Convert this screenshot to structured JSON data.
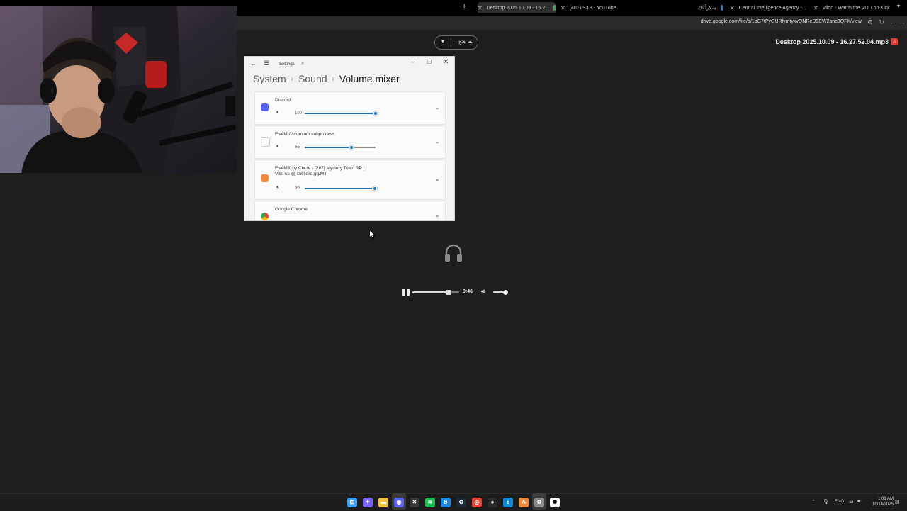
{
  "browser": {
    "tabs": [
      {
        "title": "Desktop 2025.10.09 - 16.2...",
        "favicon": "drive-icon",
        "color": "#34a853"
      },
      {
        "title": "(401) SXB - YouTube",
        "favicon": "youtube-icon",
        "color": "#ff0033"
      },
      {
        "title": "شكراً لك",
        "favicon": "blue-app-icon",
        "color": "#1e88e5"
      },
      {
        "title": "Central Intelligence Agency -...",
        "favicon": "green-square-icon",
        "color": "#43a047"
      },
      {
        "title": "Vilon - Watch the VOD on Kick",
        "favicon": "kick-icon",
        "color": "#53fc18"
      }
    ],
    "url": "drive.google.com/file/d/1oG7tPyGURlymtyxvQNReD9EW2anc3QFK/view"
  },
  "viewer": {
    "file_title": "Desktop 2025.10.09 - 16.27.52.04.mp3",
    "pill_text": "...فتح",
    "player": {
      "time": "0:46",
      "progress": 0.78,
      "volume": 0.85
    }
  },
  "settings": {
    "title": "Settings",
    "breadcrumb": [
      "System",
      "Sound",
      "Volume mixer"
    ],
    "apps": [
      {
        "name": "Discord",
        "volume": "100",
        "level": 1.0,
        "icon": "discord-icon",
        "color": "#5865f2"
      },
      {
        "name": "FiveM Chromium subprocess",
        "volume": "66",
        "level": 0.66,
        "icon": "blank-app-icon",
        "color": "#ffffff"
      },
      {
        "name": "FiveM® by Cfx.re - [262] Mystery Town RP |",
        "name2": "Visit us @ Discord.gg/MT",
        "volume": "99",
        "level": 0.99,
        "icon": "fivem-icon",
        "color": "#f0883e"
      },
      {
        "name": "Google Chrome",
        "icon": "chrome-icon",
        "color": "#fbbc05"
      }
    ]
  },
  "taskbar": {
    "language": "ENG",
    "time": "1:01 AM",
    "date": "10/14/2025",
    "pinned": [
      {
        "name": "windows-start-icon",
        "color": "#3aa0ff"
      },
      {
        "name": "copilot-icon",
        "color": "#7b61ff"
      },
      {
        "name": "file-explorer-icon",
        "color": "#f5c242"
      },
      {
        "name": "discord-taskbar-icon",
        "color": "#5865f2"
      },
      {
        "name": "xbox-icon",
        "color": "#3a3a3a"
      },
      {
        "name": "spotify-icon",
        "color": "#1db954"
      },
      {
        "name": "bing-icon",
        "color": "#1e88e5"
      },
      {
        "name": "steam-icon",
        "color": "#1b2838"
      },
      {
        "name": "chrome-taskbar-icon",
        "color": "#ea4335"
      },
      {
        "name": "obs-icon",
        "color": "#2b2b2b"
      },
      {
        "name": "edge-icon",
        "color": "#0f8bd6"
      },
      {
        "name": "fivem-taskbar-icon",
        "color": "#f0883e"
      },
      {
        "name": "settings-taskbar-icon",
        "color": "#8a8a8a"
      },
      {
        "name": "openai-icon",
        "color": "#ffffff"
      }
    ]
  }
}
